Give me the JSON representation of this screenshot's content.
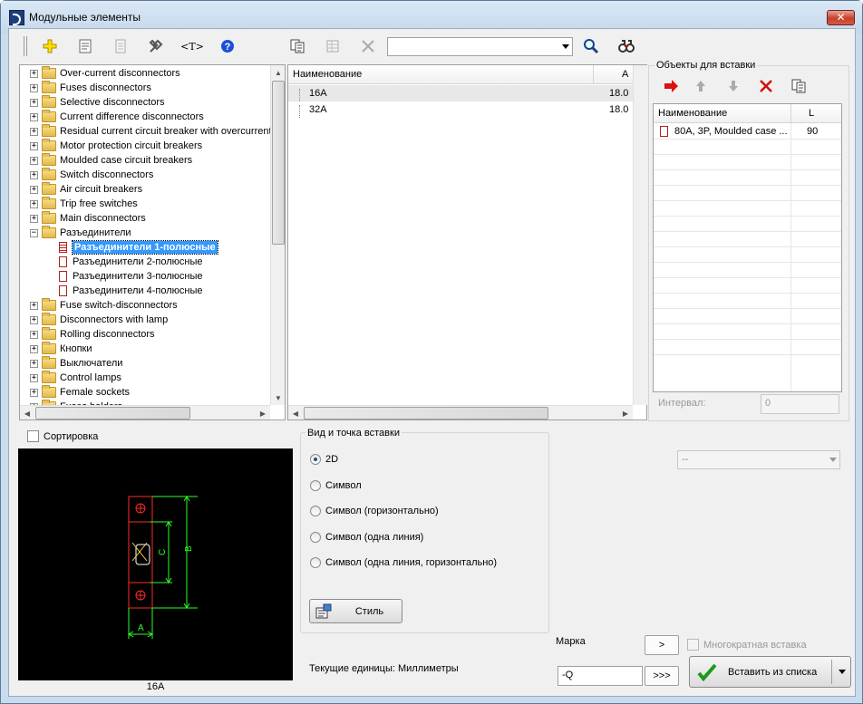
{
  "window": {
    "title": "Модульные элементы",
    "close_label": "✕"
  },
  "toolbar": {
    "search_value": ""
  },
  "tree": {
    "items": [
      {
        "label": "Over-current disconnectors",
        "type": "folder"
      },
      {
        "label": "Fuses disconnectors",
        "type": "folder"
      },
      {
        "label": "Selective disconnectors",
        "type": "folder"
      },
      {
        "label": "Current difference disconnectors",
        "type": "folder"
      },
      {
        "label": "Residual current circuit breaker with overcurrent",
        "type": "folder"
      },
      {
        "label": "Motor protection circuit breakers",
        "type": "folder"
      },
      {
        "label": "Moulded case circuit breakers",
        "type": "folder"
      },
      {
        "label": "Switch disconnectors",
        "type": "folder"
      },
      {
        "label": "Air circuit breakers",
        "type": "folder"
      },
      {
        "label": "Trip free switches",
        "type": "folder"
      },
      {
        "label": "Main disconnectors",
        "type": "folder"
      },
      {
        "label": "Разъединители",
        "type": "folder-open"
      },
      {
        "label": "Разъединители 1-полюсные",
        "type": "leaf-selected"
      },
      {
        "label": "Разъединители 2-полюсные",
        "type": "leaf"
      },
      {
        "label": "Разъединители 3-полюсные",
        "type": "leaf"
      },
      {
        "label": "Разъединители 4-полюсные",
        "type": "leaf"
      },
      {
        "label": "Fuse switch-disconnectors",
        "type": "folder"
      },
      {
        "label": "Disconnectors with lamp",
        "type": "folder"
      },
      {
        "label": "Rolling disconnectors",
        "type": "folder"
      },
      {
        "label": "Кнопки",
        "type": "folder"
      },
      {
        "label": "Выключатели",
        "type": "folder"
      },
      {
        "label": "Control lamps",
        "type": "folder"
      },
      {
        "label": "Female sockets",
        "type": "folder"
      },
      {
        "label": "Fuses holders",
        "type": "folder"
      }
    ]
  },
  "list": {
    "col_name": "Наименование",
    "col_a": "A",
    "rows": [
      {
        "name": "16A",
        "a": "18.0"
      },
      {
        "name": "32A",
        "a": "18.0"
      }
    ]
  },
  "insert": {
    "group_label": "Объекты для вставки",
    "col_name": "Наименование",
    "col_l": "L",
    "rows": [
      {
        "name": "80A, 3P, Moulded case ...",
        "l": "90"
      }
    ],
    "interval_label": "Интервал:",
    "interval_value": "0"
  },
  "sort_label": "Сортировка",
  "preview": {
    "caption": "16A",
    "dim_a": "A",
    "dim_b": "B",
    "dim_c": "C"
  },
  "view": {
    "group_label": "Вид и точка вставки",
    "options": [
      "2D",
      "Символ",
      "Символ (горизонтально)",
      "Символ (одна линия)",
      "Символ (одна линия, горизонтально)"
    ],
    "selected": "2D",
    "style_button": "Стиль",
    "units_label": "Текущие единицы: Миллиметры"
  },
  "right_combo_value": "--",
  "mark": {
    "label": "Марка",
    "value": "-Q",
    "btn_single": ">",
    "btn_multi": ">>>"
  },
  "multi_insert_label": "Многократная вставка",
  "insert_button": "Вставить из списка",
  "colors": {
    "selection": "#3399ff",
    "preview_bg": "#000000",
    "preview_red": "#ff2a2a",
    "preview_green": "#2bff2b"
  }
}
